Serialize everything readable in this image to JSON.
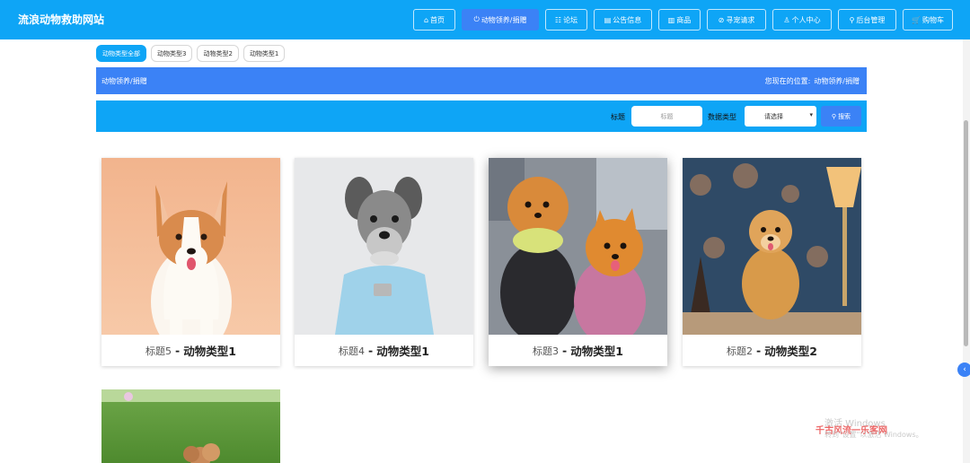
{
  "site_title": "流浪动物救助网站",
  "nav": [
    {
      "icon": "⌂",
      "label": "首页",
      "active": false
    },
    {
      "icon": "⏻",
      "label": "动物领养/捐赠",
      "active": true
    },
    {
      "icon": "☷",
      "label": "论坛",
      "active": false
    },
    {
      "icon": "▤",
      "label": "公告信息",
      "active": false
    },
    {
      "icon": "▥",
      "label": "商品",
      "active": false
    },
    {
      "icon": "⊘",
      "label": "寻宠请求",
      "active": false
    },
    {
      "icon": "♙",
      "label": "个人中心",
      "active": false
    },
    {
      "icon": "⚲",
      "label": "后台管理",
      "active": false
    },
    {
      "icon": "🛒",
      "label": "购物车",
      "active": false
    }
  ],
  "filters": [
    "动物类型全部",
    "动物类型3",
    "动物类型2",
    "动物类型1"
  ],
  "crumb": {
    "title": "动物领养/捐赠",
    "location_prefix": "您现在的位置:",
    "location": "动物领养/捐赠"
  },
  "search": {
    "title_label": "标题",
    "title_placeholder": "标题",
    "type_label": "数据类型",
    "type_selected": "请选择",
    "button_label": "搜索"
  },
  "cards": [
    {
      "title": "标题5",
      "sep": "-",
      "type": "动物类型1"
    },
    {
      "title": "标题4",
      "sep": "-",
      "type": "动物类型1"
    },
    {
      "title": "标题3",
      "sep": "-",
      "type": "动物类型1"
    },
    {
      "title": "标题2",
      "sep": "-",
      "type": "动物类型2"
    }
  ],
  "watermark": {
    "line1": "激活 Windows",
    "line2": "千古风流一乐客网",
    "line3": "转到\"设置\"以激活 Windows。"
  },
  "colors": {
    "primary": "#0ea5f6",
    "accent": "#3b82f6"
  }
}
